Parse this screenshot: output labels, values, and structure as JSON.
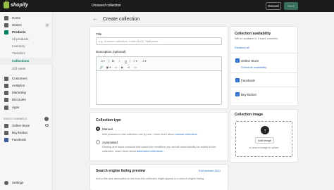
{
  "topbar": {
    "logo_text": "shopify",
    "title": "Unsaved collection",
    "discard_label": "Discard",
    "save_label": "Save"
  },
  "sidebar": {
    "items": [
      {
        "label": "Home",
        "icon": "home-icon"
      },
      {
        "label": "Orders",
        "icon": "orders-icon",
        "badge": "2"
      },
      {
        "label": "Products",
        "icon": "products-icon"
      },
      {
        "label": "All products"
      },
      {
        "label": "Inventory"
      },
      {
        "label": "Transfers"
      },
      {
        "label": "Collections"
      },
      {
        "label": "Gift cards"
      },
      {
        "label": "Customers",
        "icon": "customers-icon"
      },
      {
        "label": "Analytics",
        "icon": "analytics-icon"
      },
      {
        "label": "Marketing",
        "icon": "marketing-icon"
      },
      {
        "label": "Discounts",
        "icon": "discounts-icon"
      },
      {
        "label": "Apps",
        "icon": "apps-icon"
      }
    ],
    "channels_title": "SALES CHANNELS",
    "channels": [
      {
        "label": "Online Store"
      },
      {
        "label": "Buy Button"
      },
      {
        "label": "Facebook"
      }
    ],
    "settings_label": "Settings"
  },
  "page": {
    "back_icon": "←",
    "title": "Create collection"
  },
  "main_card": {
    "title_label": "Title",
    "title_placeholder": "e.g. Summer collection, Under $100, Staff picks",
    "description_label": "Description (optional)",
    "toolbar": [
      "A ▾",
      "B",
      "I",
      "U",
      "≡ ▾",
      "A ▾",
      "🔗",
      "▣ ▾",
      "▭",
      "▶",
      "⊘",
      "<>"
    ]
  },
  "collection_type": {
    "title": "Collection type",
    "manual_label": "Manual",
    "manual_help": "Add products to this collection one by one. Learn more about",
    "manual_link": "manual collections.",
    "automated_label": "Automated",
    "automated_help": "Existing and future products that match the conditions you set will automatically be added to this collection. Learn more about",
    "automated_link": "automated collections."
  },
  "seo": {
    "title": "Search engine listing preview",
    "edit_link": "Edit website SEO",
    "help": "Add a title and description to see how this collection might appear in a search engine listing"
  },
  "availability": {
    "title": "Collection availability",
    "subtitle": "Will be available to 3 sales channels.",
    "deselect": "Deselect all",
    "channels": [
      {
        "label": "Online Store",
        "extra": "Schedule availability"
      },
      {
        "label": "Facebook"
      },
      {
        "label": "Buy Button"
      }
    ]
  },
  "image_card": {
    "title": "Collection image",
    "add_label": "Add image",
    "drop_hint": "or drop an image to upload"
  },
  "colors": {
    "accent": "#008060",
    "link": "#2c6ecb",
    "topbar": "#1a1a1a"
  }
}
